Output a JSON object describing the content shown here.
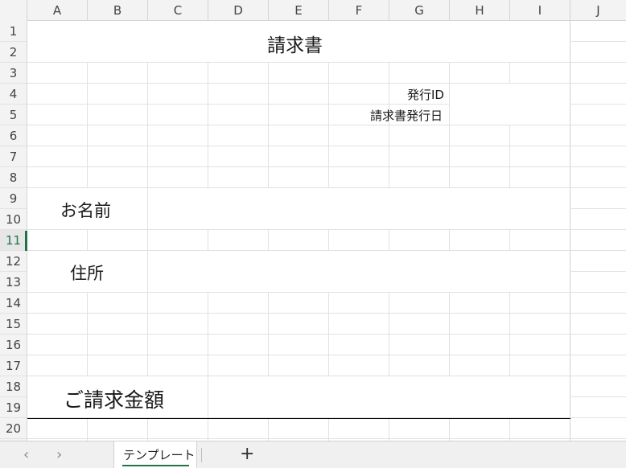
{
  "columns": [
    "A",
    "B",
    "C",
    "D",
    "E",
    "F",
    "G",
    "H",
    "I",
    "J"
  ],
  "rows": [
    "1",
    "2",
    "3",
    "4",
    "5",
    "6",
    "7",
    "8",
    "9",
    "10",
    "11",
    "12",
    "13",
    "14",
    "15",
    "16",
    "17",
    "18",
    "19",
    "20"
  ],
  "active_row": "11",
  "sheet": {
    "title": "請求書",
    "issue_id_label": "発行ID",
    "issue_date_label": "請求書発行日",
    "name_label": "お名前",
    "address_label": "住所",
    "amount_label": "ご請求金額"
  },
  "tabs": {
    "nav_prev": "‹",
    "nav_next": "›",
    "sheet_name": "テンプレート",
    "add_sheet": "+"
  },
  "colors": {
    "accent": "#217346",
    "gridline": "#e1e1e1",
    "header_bg": "#f3f3f3"
  }
}
